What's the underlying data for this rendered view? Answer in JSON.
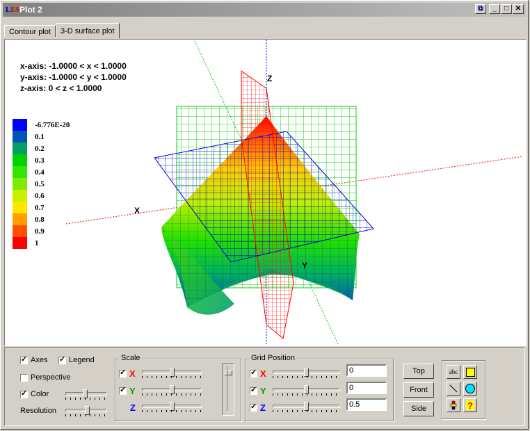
{
  "window": {
    "title": "Plot 2",
    "icon": "les-app-icon"
  },
  "tabs": [
    {
      "label": "Contour plot"
    },
    {
      "label": "3-D surface plot"
    }
  ],
  "axis_info": [
    "x-axis: -1.0000 < x < 1.0000",
    "y-axis: -1.0000 < y < 1.0000",
    "z-axis: 0 < z < 1.0000"
  ],
  "legend": [
    {
      "label": "-6.776E-20",
      "color": "#0000ff"
    },
    {
      "label": "0.1",
      "color": "#0055b4"
    },
    {
      "label": "0.2",
      "color": "#00a064"
    },
    {
      "label": "0.3",
      "color": "#00d200"
    },
    {
      "label": "0.4",
      "color": "#32e600"
    },
    {
      "label": "0.5",
      "color": "#7ded00"
    },
    {
      "label": "0.6",
      "color": "#c8f000"
    },
    {
      "label": "0.7",
      "color": "#ffe600"
    },
    {
      "label": "0.8",
      "color": "#ffa000"
    },
    {
      "label": "0.9",
      "color": "#ff5000"
    },
    {
      "label": "1",
      "color": "#ff0000"
    }
  ],
  "axis_labels": {
    "x": "X",
    "y": "Y",
    "z": "Z"
  },
  "controls": {
    "axes": {
      "label": "Axes",
      "checked": true
    },
    "legend": {
      "label": "Legend",
      "checked": true
    },
    "perspective": {
      "label": "Perspective",
      "checked": false
    },
    "color": {
      "label": "Color",
      "checked": true
    },
    "resolution": {
      "label": "Resolution"
    }
  },
  "scale": {
    "title": "Scale",
    "x": "X",
    "y": "Y",
    "z": "Z"
  },
  "grid_position": {
    "title": "Grid Position",
    "x": {
      "label": "X",
      "value": "0"
    },
    "y": {
      "label": "Y",
      "value": "0"
    },
    "z": {
      "label": "Z",
      "value": "0.5"
    }
  },
  "buttons": {
    "top": "Top",
    "front": "Front",
    "side": "Side"
  },
  "tools": {
    "text": "abc"
  },
  "colors": {
    "x_axis": "#ff0000",
    "y_axis": "#00a000",
    "z_axis": "#0000ff"
  }
}
